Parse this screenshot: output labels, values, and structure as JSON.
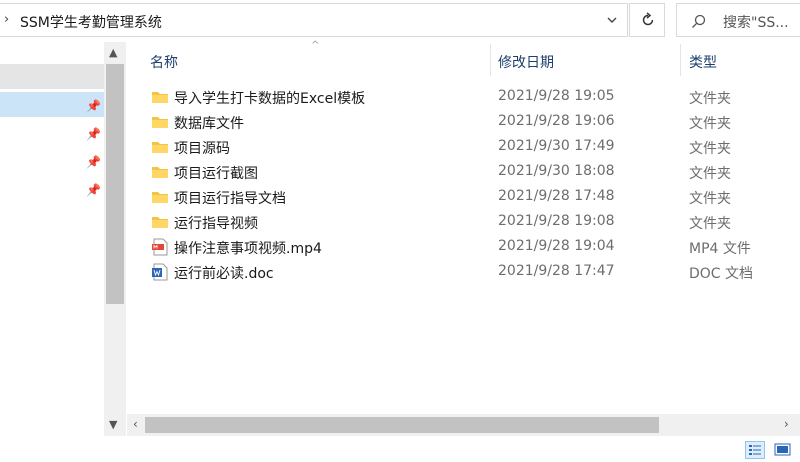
{
  "address": {
    "path": "SSM学生考勤管理系统"
  },
  "search": {
    "placeholder": "搜索\"SS..."
  },
  "columns": {
    "name": "名称",
    "date": "修改日期",
    "type": "类型"
  },
  "files": [
    {
      "name": "导入学生打卡数据的Excel模板",
      "date": "2021/9/28 19:05",
      "type": "文件夹",
      "icon": "folder-icon"
    },
    {
      "name": "数据库文件",
      "date": "2021/9/28 19:06",
      "type": "文件夹",
      "icon": "folder-icon"
    },
    {
      "name": "项目源码",
      "date": "2021/9/30 17:49",
      "type": "文件夹",
      "icon": "folder-icon"
    },
    {
      "name": "项目运行截图",
      "date": "2021/9/30 18:08",
      "type": "文件夹",
      "icon": "folder-icon"
    },
    {
      "name": "项目运行指导文档",
      "date": "2021/9/28 17:48",
      "type": "文件夹",
      "icon": "folder-icon"
    },
    {
      "name": "运行指导视频",
      "date": "2021/9/28 19:08",
      "type": "文件夹",
      "icon": "folder-icon"
    },
    {
      "name": "操作注意事项视频.mp4",
      "date": "2021/9/28 19:04",
      "type": "MP4 文件",
      "icon": "mp4-file-icon"
    },
    {
      "name": "运行前必读.doc",
      "date": "2021/9/28 17:47",
      "type": "DOC 文档",
      "icon": "word-doc-icon"
    }
  ],
  "colors": {
    "selection": "#cce4f7",
    "header_text": "#1c3f6e",
    "folder": "#f5c342"
  }
}
